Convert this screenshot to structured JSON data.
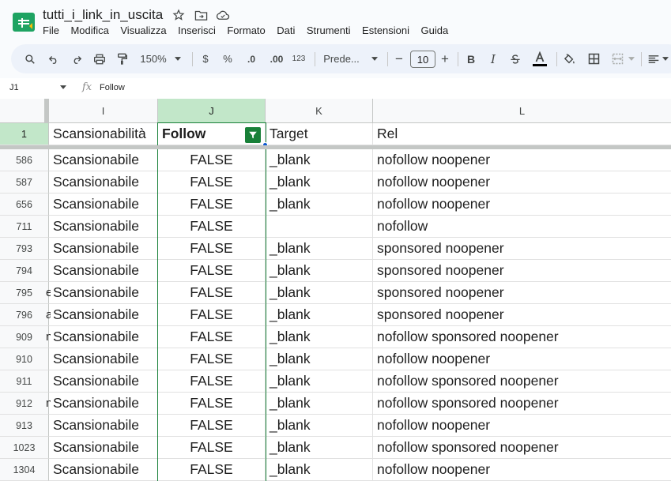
{
  "app": {
    "doc_title": "tutti_i_link_in_uscita",
    "menu": [
      "File",
      "Modifica",
      "Visualizza",
      "Inserisci",
      "Formato",
      "Dati",
      "Strumenti",
      "Estensioni",
      "Guida"
    ]
  },
  "toolbar": {
    "zoom": "150%",
    "currency": "$",
    "percent": "%",
    "decrease_decimals": ".0",
    "increase_decimals": ".00",
    "number_format": "123",
    "font_name": "Prede...",
    "font_size": "10",
    "minus": "−",
    "plus": "+",
    "bold": "B",
    "italic": "I"
  },
  "formula_bar": {
    "name_box": "J1",
    "fx": "fx",
    "value": "Follow"
  },
  "grid": {
    "columns": [
      "I",
      "J",
      "K",
      "L"
    ],
    "header_row": {
      "number": "1",
      "cells": [
        "Scansionabilità",
        "Follow",
        "Target",
        "Rel"
      ]
    },
    "rows": [
      {
        "num": "586",
        "i": "Scansionabile",
        "j": "FALSE",
        "k": "_blank",
        "l": "nofollow noopener"
      },
      {
        "num": "587",
        "i": "Scansionabile",
        "j": "FALSE",
        "k": "_blank",
        "l": "nofollow noopener"
      },
      {
        "num": "656",
        "i": "Scansionabile",
        "j": "FALSE",
        "k": "_blank",
        "l": "nofollow noopener"
      },
      {
        "num": "711",
        "i": "Scansionabile",
        "j": "FALSE",
        "k": "",
        "l": "nofollow"
      },
      {
        "num": "793",
        "i": "Scansionabile",
        "j": "FALSE",
        "k": "_blank",
        "l": "sponsored noopener"
      },
      {
        "num": "794",
        "i": "Scansionabile",
        "j": "FALSE",
        "k": "_blank",
        "l": "sponsored noopener"
      },
      {
        "num": "795",
        "i": "Scansionabile",
        "j": "FALSE",
        "k": "_blank",
        "l": "sponsored noopener"
      },
      {
        "num": "796",
        "i": "Scansionabile",
        "j": "FALSE",
        "k": "_blank",
        "l": "sponsored noopener"
      },
      {
        "num": "909",
        "i": "Scansionabile",
        "j": "FALSE",
        "k": "_blank",
        "l": "nofollow sponsored noopener"
      },
      {
        "num": "910",
        "i": "Scansionabile",
        "j": "FALSE",
        "k": "_blank",
        "l": "nofollow noopener"
      },
      {
        "num": "911",
        "i": "Scansionabile",
        "j": "FALSE",
        "k": "_blank",
        "l": "nofollow sponsored noopener"
      },
      {
        "num": "912",
        "i": "Scansionabile",
        "j": "FALSE",
        "k": "_blank",
        "l": "nofollow sponsored noopener"
      },
      {
        "num": "913",
        "i": "Scansionabile",
        "j": "FALSE",
        "k": "_blank",
        "l": "nofollow noopener"
      },
      {
        "num": "1023",
        "i": "Scansionabile",
        "j": "FALSE",
        "k": "_blank",
        "l": "nofollow sponsored noopener"
      },
      {
        "num": "1304",
        "i": "Scansionabile",
        "j": "FALSE",
        "k": "_blank",
        "l": "nofollow noopener"
      }
    ]
  },
  "colors": {
    "accent_green": "#188038",
    "selected_header": "#c2e7c9",
    "toolbar_bg": "#edf2fa",
    "selection_handle": "#0b57d0"
  },
  "icons": {
    "logo": "sheets-logo-icon",
    "star": "star-icon",
    "move": "folder-move-icon",
    "cloud": "cloud-status-icon",
    "filter": "filter-icon"
  }
}
